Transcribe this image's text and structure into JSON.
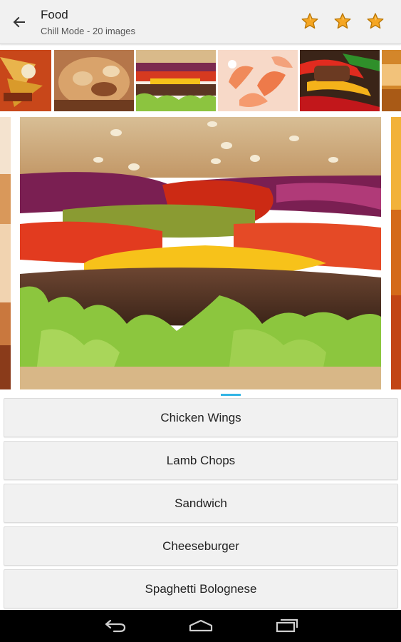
{
  "header": {
    "title": "Food",
    "subtitle": "Chill Mode - 20 images",
    "star_color": "#f5a623"
  },
  "thumbnails": [
    {
      "name": "nachos"
    },
    {
      "name": "casserole"
    },
    {
      "name": "burger"
    },
    {
      "name": "shrimp"
    },
    {
      "name": "peppers-steak"
    },
    {
      "name": "partial"
    }
  ],
  "answers": [
    {
      "label": "Chicken Wings"
    },
    {
      "label": "Lamb Chops"
    },
    {
      "label": "Sandwich"
    },
    {
      "label": "Cheeseburger"
    },
    {
      "label": "Spaghetti Bolognese"
    }
  ],
  "accent_color": "#33b5e5"
}
